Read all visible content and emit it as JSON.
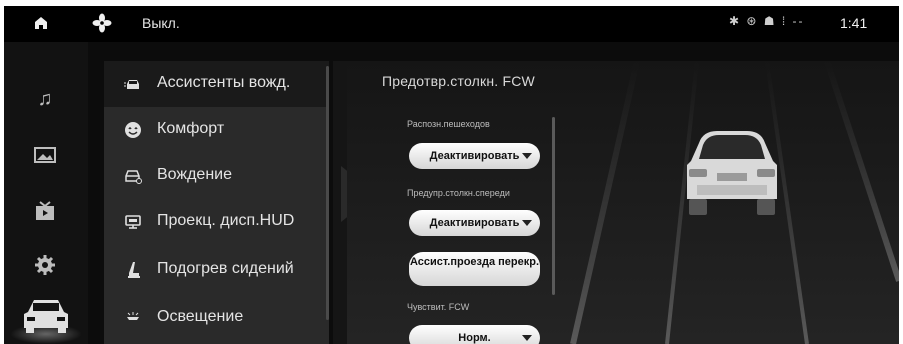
{
  "status_bar": {
    "climate_label": "Выкл.",
    "status_icons": "✱ ⊛ ☗ ⁞ --",
    "time": "1:41"
  },
  "rail": {
    "items": [
      "music-icon",
      "gallery-icon",
      "video-icon",
      "settings-icon",
      "car-icon"
    ],
    "active": "car-icon"
  },
  "menu": {
    "items": [
      {
        "label": "Ассистенты вожд.",
        "icon": "driver-assist-icon",
        "active": true
      },
      {
        "label": "Комфорт",
        "icon": "comfort-icon",
        "active": false
      },
      {
        "label": "Вождение",
        "icon": "driving-icon",
        "active": false
      },
      {
        "label": "Проекц. дисп.HUD",
        "icon": "hud-icon",
        "active": false
      },
      {
        "label": "Подогрев сидений",
        "icon": "seat-heating-icon",
        "active": false
      },
      {
        "label": "Освещение",
        "icon": "lighting-icon",
        "active": false
      }
    ]
  },
  "content": {
    "title": "Предотвр.столкн. FCW",
    "options": [
      {
        "label": "Распозн.пешеходов",
        "value": "Деактивировать"
      },
      {
        "label": "Предупр.столкн.спереди",
        "value": "Деактивировать"
      },
      {
        "label": "",
        "value": "Ассист.проезда перекр."
      },
      {
        "label": "Чувствит. FCW",
        "value": "Норм."
      }
    ]
  },
  "colors": {
    "background": "#0c0c0c",
    "menu_bg": "#2a2a2a",
    "button_bg": "#e8e8e8"
  }
}
